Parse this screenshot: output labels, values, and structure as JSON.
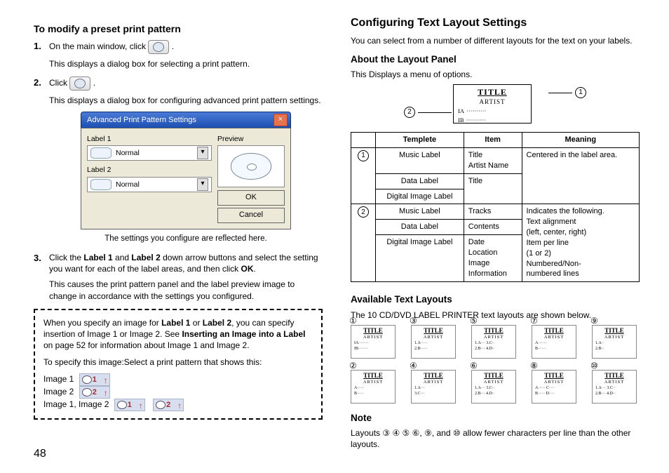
{
  "page_number": "48",
  "left": {
    "heading": "To modify a preset print pattern",
    "steps": [
      {
        "num": "1.",
        "text_a": "On the main window, click ",
        "text_b": ".",
        "after": "This displays a dialog box for selecting a print pattern."
      },
      {
        "num": "2.",
        "text_a": "Click ",
        "text_b": ".",
        "after": "This displays a dialog box for configuring advanced print pattern settings."
      },
      {
        "num": "3.",
        "l1_a": "Click the ",
        "l1_b": "Label 1",
        "l1_c": " and ",
        "l1_d": "Label 2",
        "l1_e": " down arrow buttons and select the setting you want for each of the label areas, and then click ",
        "l1_f": "OK",
        "l1_g": ".",
        "after": "This causes the print pattern panel and the label preview image to change in accordance with the settings you configured."
      }
    ],
    "dialog": {
      "title": "Advanced Print Pattern Settings",
      "label1": "Label 1",
      "label2": "Label 2",
      "normal": "Normal",
      "preview": "Preview",
      "ok": "OK",
      "cancel": "Cancel"
    },
    "caption": "The settings you configure are reflected here.",
    "note": {
      "p1_a": "When you specify an image for ",
      "p1_b": "Label 1",
      "p1_c": " or ",
      "p1_d": "Label 2",
      "p1_e": ", you can specify insertion of Image 1 or Image 2. See ",
      "p1_f": "Inserting an Image into a Label",
      "p1_g": " on page 52 for information about Image 1 and Image 2.",
      "p2": "To specify this image:Select a print pattern that shows this:",
      "row1": "Image 1",
      "row2": "Image 2",
      "row3": "Image 1, Image 2"
    }
  },
  "right": {
    "heading": "Configuring Text Layout Settings",
    "intro": "You can select from a number of different layouts for the text on your labels.",
    "about": "About the Layout Panel",
    "about_text": "This Displays a menu of options.",
    "panelbox": {
      "title": "TITLE",
      "artist": "ARTIST",
      "ia": "IA",
      "ib": "IB"
    },
    "table": {
      "h1": "Templete",
      "h2": "Item",
      "h3": "Meaning",
      "r1_t1": "Music Label",
      "r1_i1": "Title\nArtist Name",
      "r1_t2": "Data Label",
      "r1_i2": "Title",
      "r1_t3": "Digital Image Label",
      "r1_m": "Centered in the label area.",
      "r2_t1": "Music Label",
      "r2_i1": "Tracks",
      "r2_t2": "Data Label",
      "r2_i2": "Contents",
      "r2_t3": "Digital Image Label",
      "r2_i3": "Date\nLocation\nImage\nInformation",
      "r2_m": "Indicates the following.\n  Text alignment\n  (left, center, right)\n  Item per line\n  (1 or 2)\n  Numbered/Non-\n  numbered lines"
    },
    "avail_h": "Available Text Layouts",
    "avail_t": "The 10 CD/DVD LABEL PRINTER text layouts are shown below.",
    "thumbs": {
      "title": "TITLE",
      "artist": "ARTIST",
      "ids": [
        "1",
        "3",
        "5",
        "7",
        "9",
        "2",
        "4",
        "6",
        "8",
        "10"
      ],
      "lines": [
        [
          "IA·······",
          "IB·······"
        ],
        [
          "1.A·····",
          "2.B·····"
        ],
        [
          "1.A··· 3.C··",
          "2.B··· 4.D··"
        ],
        [
          "A······",
          "B······"
        ],
        [
          "1.A··",
          "2.B··"
        ],
        [
          "A·····",
          "B·····"
        ],
        [
          "1.A···",
          "3.C···"
        ],
        [
          "1.A··· 3.C··",
          "2.B··· 4.D··"
        ],
        [
          "A····· C····",
          "B····· D····"
        ],
        [
          "1.A··· 3.C··",
          "2.B··· 4.D··"
        ]
      ]
    },
    "note_h": "Note",
    "note_t": "Layouts ③ ④ ⑤ ⑥, ⑨, and ⑩ allow fewer characters per line than the other layouts."
  }
}
